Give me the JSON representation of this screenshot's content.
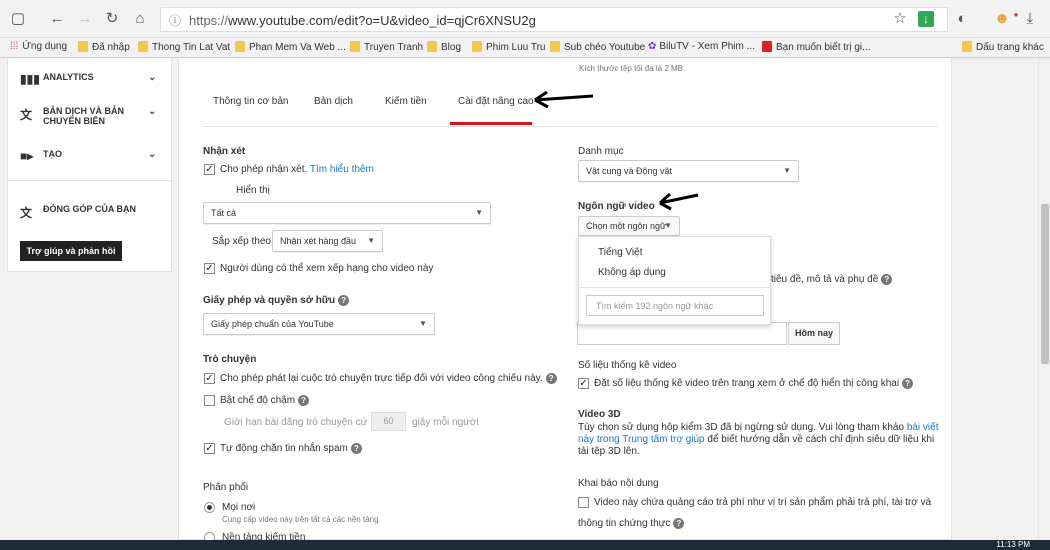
{
  "browser": {
    "url_prefix": "https://",
    "url": "www.youtube.com/edit?o=U&video_id=qjCr6XNSU2g"
  },
  "bookmarks": [
    "Ứng dụng",
    "Đã nhập",
    "Thong Tin Lat Vat",
    "Phan Mem Va Web ...",
    "Truyen Tranh",
    "Blog",
    "Phim Luu Tru",
    "Sub chéo Youtube",
    "BiluTV - Xem Phim ...",
    "Bạn muốn biết trị gi...",
    "Dấu trang khác"
  ],
  "sidebar": {
    "items": [
      {
        "label": "ANALYTICS"
      },
      {
        "label": "BẢN DỊCH VÀ BẢN CHUYỂN BIÊN"
      },
      {
        "label": "TẠO"
      },
      {
        "label": "ĐÓNG GÓP CỦA BẠN"
      }
    ],
    "help_button": "Trợ giúp và phản hồi"
  },
  "top_note": "Kích thước tệp tối đa là 2 MB.",
  "tabs": [
    "Thông tin cơ bản",
    "Bản dịch",
    "Kiếm tiền",
    "Cài đặt nâng cao"
  ],
  "comments": {
    "heading": "Nhận xét",
    "allow": "Cho phép nhận xét.",
    "learn_more": "Tìm hiểu thêm",
    "display_label": "Hiển thị",
    "display_value": "Tất cả",
    "sort_label": "Sắp xếp theo",
    "sort_value": "Nhận xét hàng đầu",
    "ratings": "Người dùng có thể xem xếp hạng cho video này"
  },
  "license": {
    "heading": "Giấy phép và quyền sở hữu",
    "value": "Giấy phép chuẩn của YouTube"
  },
  "chat": {
    "heading": "Trò chuyện",
    "replay": "Cho phép phát lại cuộc trò chuyện trực tiếp đối với video công chiếu này.",
    "slow_mode": "Bật chế độ chậm",
    "limit_prefix": "Giới hạn bài đăng trò chuyện cứ",
    "limit_value": "60",
    "limit_suffix": "giây mỗi người",
    "spam": "Tự động chặn tin nhắn spam"
  },
  "distribution": {
    "heading": "Phân phối",
    "everywhere": "Mọi nơi",
    "everywhere_desc": "Cung cấp video này trên tất cả các nền tảng",
    "monetized_platforms": "Nền tảng kiếm tiền"
  },
  "category": {
    "heading": "Danh mục",
    "value": "Vật cung và Động vật"
  },
  "language": {
    "heading": "Ngôn ngữ video",
    "button": "Chọn một ngôn ngữ",
    "options": [
      "Tiếng Việt",
      "Không áp dụng"
    ],
    "search_placeholder": "Tìm kiếm 192 ngôn ngữ khác",
    "behind_text": "tiêu đề, mô tả và phụ đề"
  },
  "today_button": "Hôm nay",
  "stats": {
    "heading": "Số liệu thống kê video",
    "label": "Đặt số liệu thống kê video trên trang xem ở chế độ hiển thị công khai"
  },
  "video3d": {
    "heading": "Video 3D",
    "text1": "Tùy chọn sử dụng hộp kiểm 3D đã bị ngừng sử dụng. Vui lòng tham khảo",
    "link1": "bài viết",
    "link2": "này trong Trung tâm trợ giúp",
    "text2": "để biết hướng dẫn về cách chỉ định siêu dữ liệu khi",
    "text3": "tải tệp 3D lên."
  },
  "disclosure": {
    "heading": "Khai báo nội dung",
    "label": "Video này chứa quảng cáo trả phí như vị trí sản phẩm phải trả phí, tài trợ và",
    "label2": "thông tin chứng thực"
  },
  "clock": "11:13 PM",
  "colors": {
    "accent": "#cc181e",
    "link": "#167ac6"
  }
}
